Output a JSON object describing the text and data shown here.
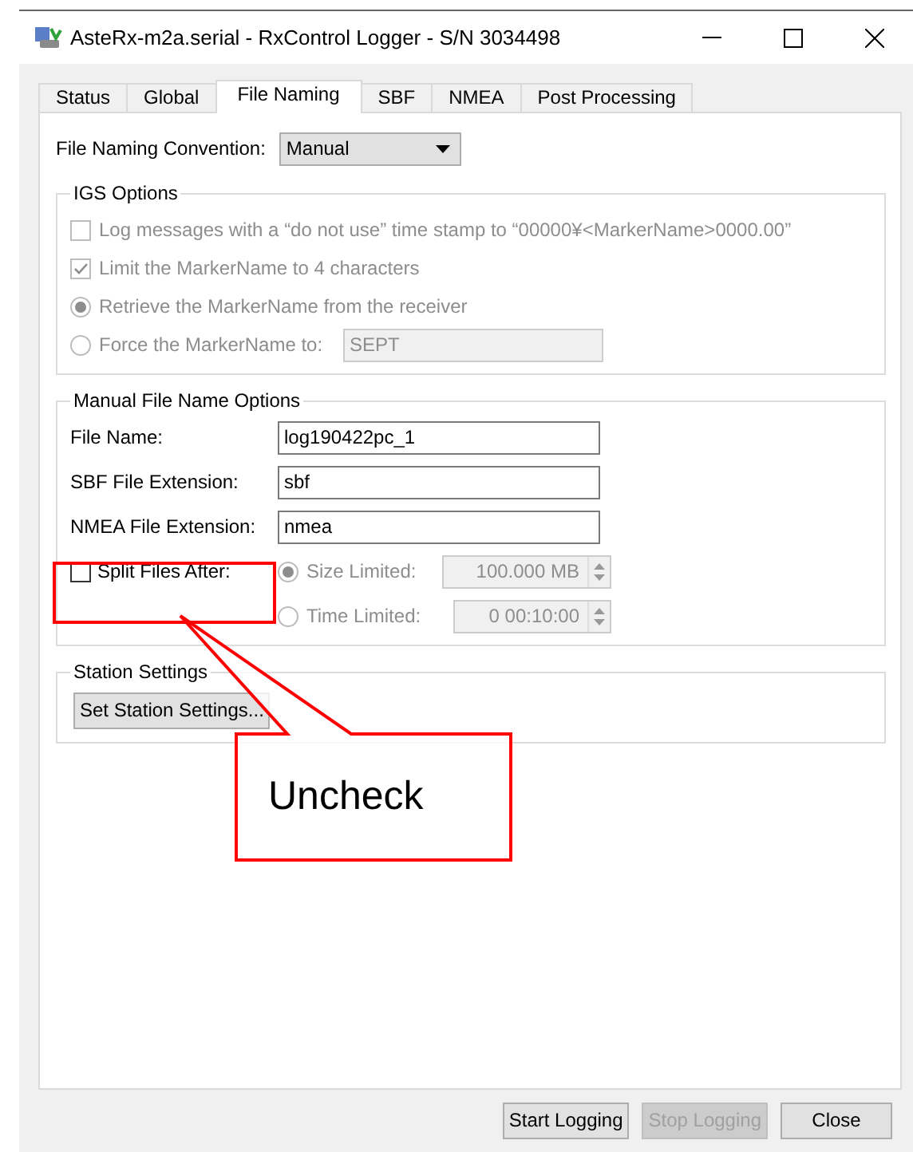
{
  "window": {
    "title": "AsteRx-m2a.serial - RxControl Logger - S/N 3034498"
  },
  "tabs": [
    {
      "label": "Status",
      "selected": false
    },
    {
      "label": "Global",
      "selected": false
    },
    {
      "label": "File Naming",
      "selected": true
    },
    {
      "label": "SBF",
      "selected": false
    },
    {
      "label": "NMEA",
      "selected": false
    },
    {
      "label": "Post Processing",
      "selected": false
    }
  ],
  "naming_convention": {
    "label": "File Naming Convention:",
    "value": "Manual"
  },
  "igs_options": {
    "title": "IGS Options",
    "disabled": true,
    "options": [
      {
        "kind": "checkbox",
        "label": "Log messages with a “do not use” time stamp to “00000¥<MarkerName>0000.00”",
        "checked": false
      },
      {
        "kind": "checkbox",
        "label": "Limit the MarkerName to 4 characters",
        "checked": true
      },
      {
        "kind": "radio",
        "label": "Retrieve the MarkerName from the receiver",
        "selected": true
      },
      {
        "kind": "radio",
        "label": "Force the MarkerName to:",
        "selected": false,
        "value": "SEPT"
      }
    ]
  },
  "manual_options": {
    "title": "Manual File Name Options",
    "fields": [
      {
        "label": "File Name:",
        "value": "log190422pc_1"
      },
      {
        "label": "SBF File Extension:",
        "value": "sbf"
      },
      {
        "label": "NMEA File Extension:",
        "value": "nmea"
      }
    ],
    "split": {
      "label": "Split Files After:",
      "checked": false
    },
    "limits_disabled": true,
    "limits": [
      {
        "label": "Size Limited:",
        "selected": true,
        "value": "100.000 MB"
      },
      {
        "label": "Time Limited:",
        "selected": false,
        "value": "0 00:10:00"
      }
    ]
  },
  "station_settings": {
    "title": "Station Settings",
    "button": "Set Station Settings..."
  },
  "annotation": {
    "text": "Uncheck"
  },
  "buttons": [
    {
      "label": "Start Logging",
      "disabled": false
    },
    {
      "label": "Stop Logging",
      "disabled": true
    },
    {
      "label": "Close",
      "disabled": false
    }
  ]
}
